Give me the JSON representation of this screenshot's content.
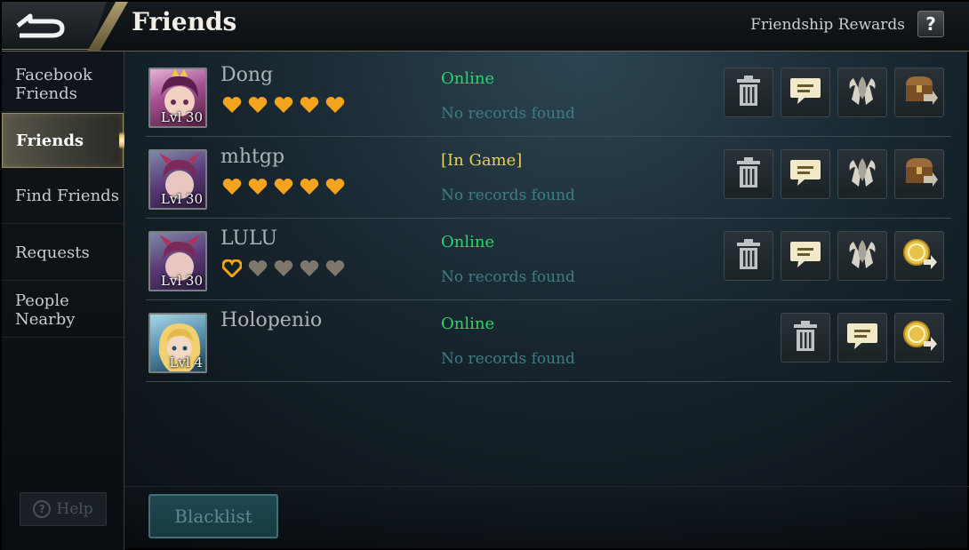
{
  "header": {
    "title": "Friends",
    "rewards_label": "Friendship Rewards",
    "help_glyph": "?"
  },
  "sidebar": {
    "items": [
      {
        "label": "Facebook\nFriends",
        "active": false
      },
      {
        "label": "Friends",
        "active": true
      },
      {
        "label": "Find Friends",
        "active": false
      },
      {
        "label": "Requests",
        "active": false
      },
      {
        "label": "People\nNearby",
        "active": false
      }
    ],
    "help_label": "Help"
  },
  "friends": [
    {
      "name": "Dong",
      "level": "Lvl 30",
      "status": "Online",
      "status_color": "#2fd36d",
      "records": "No records found",
      "hearts_filled": 5,
      "hearts_total": 5,
      "actions": [
        "delete-icon",
        "chat-icon",
        "team-icon",
        "chest-icon"
      ]
    },
    {
      "name": "mhtgp",
      "level": "Lvl 30",
      "status": "[In Game]",
      "status_color": "#e8cf55",
      "records": "No records found",
      "hearts_filled": 5,
      "hearts_total": 5,
      "actions": [
        "delete-icon",
        "chat-icon",
        "team-icon",
        "chest-icon"
      ]
    },
    {
      "name": "LULU",
      "level": "Lvl 30",
      "status": "Online",
      "status_color": "#2fd36d",
      "records": "No records found",
      "hearts_filled": 0,
      "hearts_total": 5,
      "actions": [
        "delete-icon",
        "chat-icon",
        "team-icon",
        "gift-icon"
      ]
    },
    {
      "name": "Holopenio",
      "level": "Lvl 4",
      "status": "Online",
      "status_color": "#2fd36d",
      "records": "No records found",
      "hearts_filled": 0,
      "hearts_total": 0,
      "actions": [
        "delete-icon",
        "chat-icon",
        "gift-icon"
      ]
    }
  ],
  "footer": {
    "blacklist_label": "Blacklist"
  },
  "colors": {
    "heart_filled": "#f3a31c",
    "heart_empty": "#7d776c",
    "records": "#3d7e84",
    "accent_gold": "#c9b47e"
  }
}
